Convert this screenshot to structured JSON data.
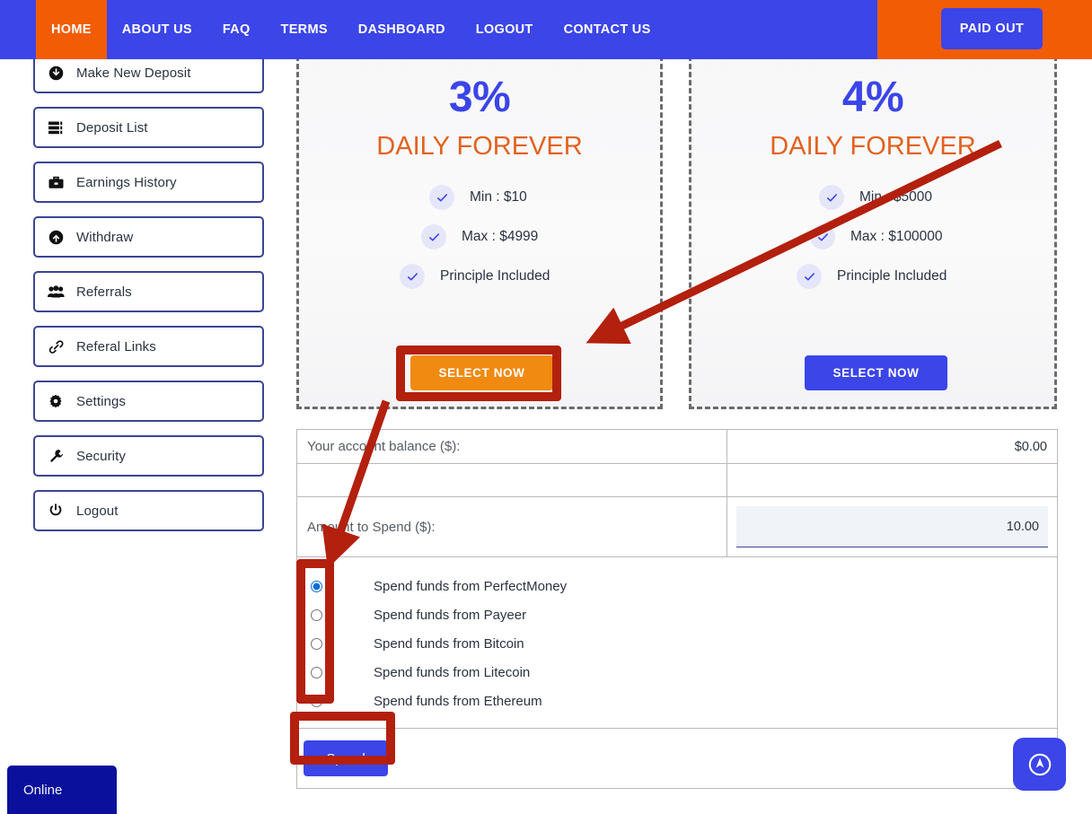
{
  "header": {
    "nav_items": [
      {
        "label": "HOME",
        "active": true
      },
      {
        "label": "ABOUT US",
        "active": false
      },
      {
        "label": "FAQ",
        "active": false
      },
      {
        "label": "TERMS",
        "active": false
      },
      {
        "label": "DASHBOARD",
        "active": false
      },
      {
        "label": "LOGOUT",
        "active": false
      },
      {
        "label": "CONTACT US",
        "active": false
      }
    ],
    "paid_out_label": "PAID OUT",
    "nav_bg": "#3b45e8",
    "active_bg": "#f25c05",
    "right_panel_bg": "#f25c05"
  },
  "sidebar": {
    "items": [
      {
        "label": "Make New Deposit",
        "icon": "download-circle-icon"
      },
      {
        "label": "Deposit List",
        "icon": "list-server-icon"
      },
      {
        "label": "Earnings History",
        "icon": "briefcase-icon"
      },
      {
        "label": "Withdraw",
        "icon": "upload-circle-icon"
      },
      {
        "label": "Referrals",
        "icon": "users-icon"
      },
      {
        "label": "Referal Links",
        "icon": "link-icon"
      },
      {
        "label": "Settings",
        "icon": "gear-icon"
      },
      {
        "label": "Security",
        "icon": "wrench-icon"
      },
      {
        "label": "Logout",
        "icon": "power-icon"
      }
    ],
    "border_color": "#3b4494"
  },
  "plans": [
    {
      "rate": "3%",
      "period": "DAILY FOREVER",
      "features": [
        "Min : $10",
        "Max : $4999",
        "Principle Included"
      ],
      "button_label": "SELECT NOW",
      "button_color": "#f08a10",
      "highlighted": true
    },
    {
      "rate": "4%",
      "period": "DAILY FOREVER",
      "features": [
        "Min : $5000",
        "Max : $100000",
        "Principle Included"
      ],
      "button_label": "SELECT NOW",
      "button_color": "#3b45e8",
      "highlighted": false
    }
  ],
  "form": {
    "balance_label": "Your account balance ($):",
    "balance_value": "$0.00",
    "amount_label": "Amount to Spend ($):",
    "amount_value": "10.00",
    "amount_placeholder": "10.00",
    "payment_options": [
      {
        "label": "Spend funds from PerfectMoney",
        "selected": true
      },
      {
        "label": "Spend funds from Payeer",
        "selected": false
      },
      {
        "label": "Spend funds from Bitcoin",
        "selected": false
      },
      {
        "label": "Spend funds from Litecoin",
        "selected": false
      },
      {
        "label": "Spend funds from Ethereum",
        "selected": false
      }
    ],
    "submit_label": "Spend"
  },
  "widgets": {
    "chat_label": "Online",
    "chat_bg": "#0a109c",
    "fab_icon": "navigation-circle-icon",
    "fab_bg": "#3b45e8"
  },
  "annotations": {
    "color": "#b3200e",
    "arrow_1_note": "points from right plan card area to highlighted SELECT NOW button",
    "arrow_2_note": "points from SELECT NOW button down to payment option radios"
  }
}
